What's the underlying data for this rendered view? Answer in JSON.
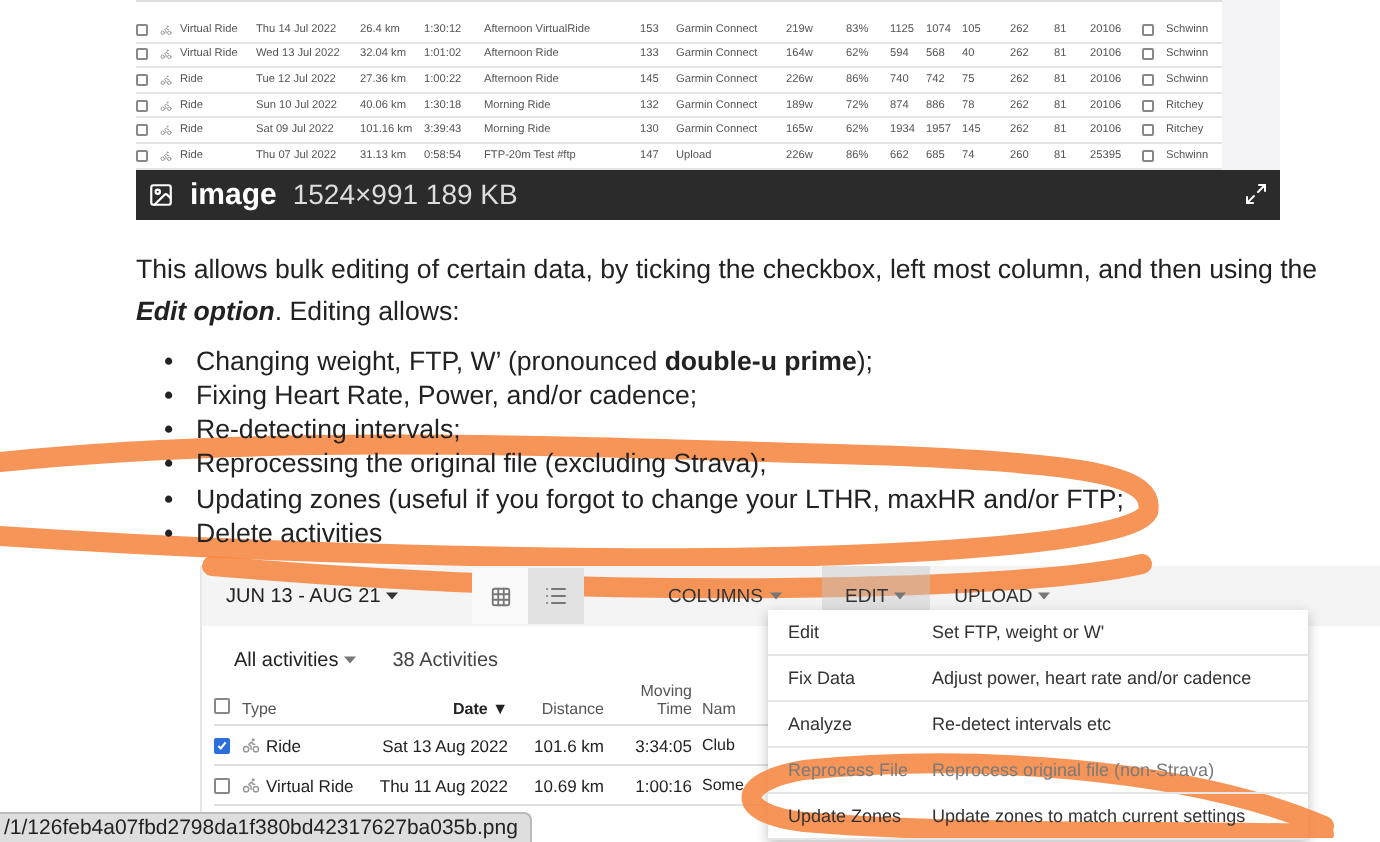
{
  "top_table": {
    "rows": [
      {
        "checked": false,
        "cells": [
          "Virtual Ride",
          "Thu 14 Jul 2022",
          "26.4 km",
          "1:30:12",
          "Afternoon VirtualRide",
          "153",
          "Garmin Connect",
          "219w",
          "83%",
          "1125",
          "1074",
          "105",
          "262",
          "81",
          "20106"
        ],
        "gear_checked": false,
        "gear": "Schwinn"
      },
      {
        "checked": false,
        "cells": [
          "Virtual Ride",
          "Wed 13 Jul 2022",
          "32.04 km",
          "1:01:02",
          "Afternoon Ride",
          "133",
          "Garmin Connect",
          "164w",
          "62%",
          "594",
          "568",
          "40",
          "262",
          "81",
          "20106"
        ],
        "gear_checked": false,
        "gear": "Schwinn"
      },
      {
        "checked": false,
        "cells": [
          "Ride",
          "Tue 12 Jul 2022",
          "27.36 km",
          "1:00:22",
          "Afternoon Ride",
          "145",
          "Garmin Connect",
          "226w",
          "86%",
          "740",
          "742",
          "75",
          "262",
          "81",
          "20106"
        ],
        "gear_checked": false,
        "gear": "Schwinn"
      },
      {
        "checked": false,
        "cells": [
          "Ride",
          "Sun 10 Jul 2022",
          "40.06 km",
          "1:30:18",
          "Morning Ride",
          "132",
          "Garmin Connect",
          "189w",
          "72%",
          "874",
          "886",
          "78",
          "262",
          "81",
          "20106"
        ],
        "gear_checked": false,
        "gear": "Ritchey"
      },
      {
        "checked": false,
        "cells": [
          "Ride",
          "Sat 09 Jul 2022",
          "101.16 km",
          "3:39:43",
          "Morning Ride",
          "130",
          "Garmin Connect",
          "165w",
          "62%",
          "1934",
          "1957",
          "145",
          "262",
          "81",
          "20106"
        ],
        "gear_checked": false,
        "gear": "Ritchey"
      },
      {
        "checked": false,
        "cells": [
          "Ride",
          "Thu 07 Jul 2022",
          "31.13 km",
          "0:58:54",
          "FTP-20m Test #ftp",
          "147",
          "Upload",
          "226w",
          "86%",
          "662",
          "685",
          "74",
          "260",
          "81",
          "25395"
        ],
        "gear_checked": false,
        "gear": "Schwinn"
      }
    ]
  },
  "image_bar": {
    "label": "image",
    "info": "1524×991 189 KB"
  },
  "paragraph": "This allows bulk editing of certain data, by ticking the checkbox, left most column, and then using the **Edit option**. Editing allows:",
  "bullets": [
    {
      "marker": "•",
      "text": "Changing weight, FTP, W’ (pronounced **double-u prime**);"
    },
    {
      "marker": "•",
      "text": "Fixing Heart Rate, Power, and/or cadence;"
    },
    {
      "marker": "•",
      "text": "Re-detecting intervals;"
    },
    {
      "marker": "•",
      "text": "Reprocessing the original file (excluding Strava);"
    },
    {
      "marker": "•",
      "text": "Updating zones (useful if you forgot to change your LTHR, maxHR and/or FTP;"
    },
    {
      "marker": "•",
      "text": "Delete activities"
    }
  ],
  "app": {
    "date_range": "JUN 13 - AUG 21",
    "views": [
      {
        "kind": "grid",
        "selected": false
      },
      {
        "kind": "list",
        "selected": true
      }
    ],
    "menus": [
      {
        "label": "COLUMNS",
        "open": false
      },
      {
        "label": "EDIT",
        "open": true
      },
      {
        "label": "UPLOAD",
        "open": false
      }
    ],
    "filter": "All activities",
    "count": "38 Activities",
    "header_checked": false,
    "sort_mark": "▼",
    "columns": [
      {
        "label": "Type",
        "sorted": false
      },
      {
        "label": "Date",
        "sorted": true
      },
      {
        "label": "Distance",
        "sorted": false
      },
      {
        "label": "Moving Time",
        "sorted": false
      },
      {
        "label": "Nam",
        "sorted": false
      }
    ],
    "rows": [
      {
        "checked": true,
        "type": "Ride",
        "date": "Sat 13 Aug 2022",
        "distance": "101.6 km",
        "time": "3:34:05",
        "name": "Club"
      },
      {
        "checked": false,
        "type": "Virtual Ride",
        "date": "Thu 11 Aug 2022",
        "distance": "10.69 km",
        "time": "1:00:16",
        "name": "Some"
      }
    ],
    "edit_menu": [
      {
        "label": "Edit",
        "description": "Set FTP, weight or W'",
        "disabled": false
      },
      {
        "label": "Fix Data",
        "description": "Adjust power, heart rate and/or cadence",
        "disabled": false
      },
      {
        "label": "Analyze",
        "description": "Re-detect intervals etc",
        "disabled": false
      },
      {
        "label": "Reprocess File",
        "description": "Reprocess original file (non-Strava)",
        "disabled": true
      },
      {
        "label": "Update Zones",
        "description": "Update zones to match current settings",
        "disabled": false
      }
    ]
  },
  "status_url": "/1/126feb4a07fbd2798da1f380bd42317627ba035b.png"
}
